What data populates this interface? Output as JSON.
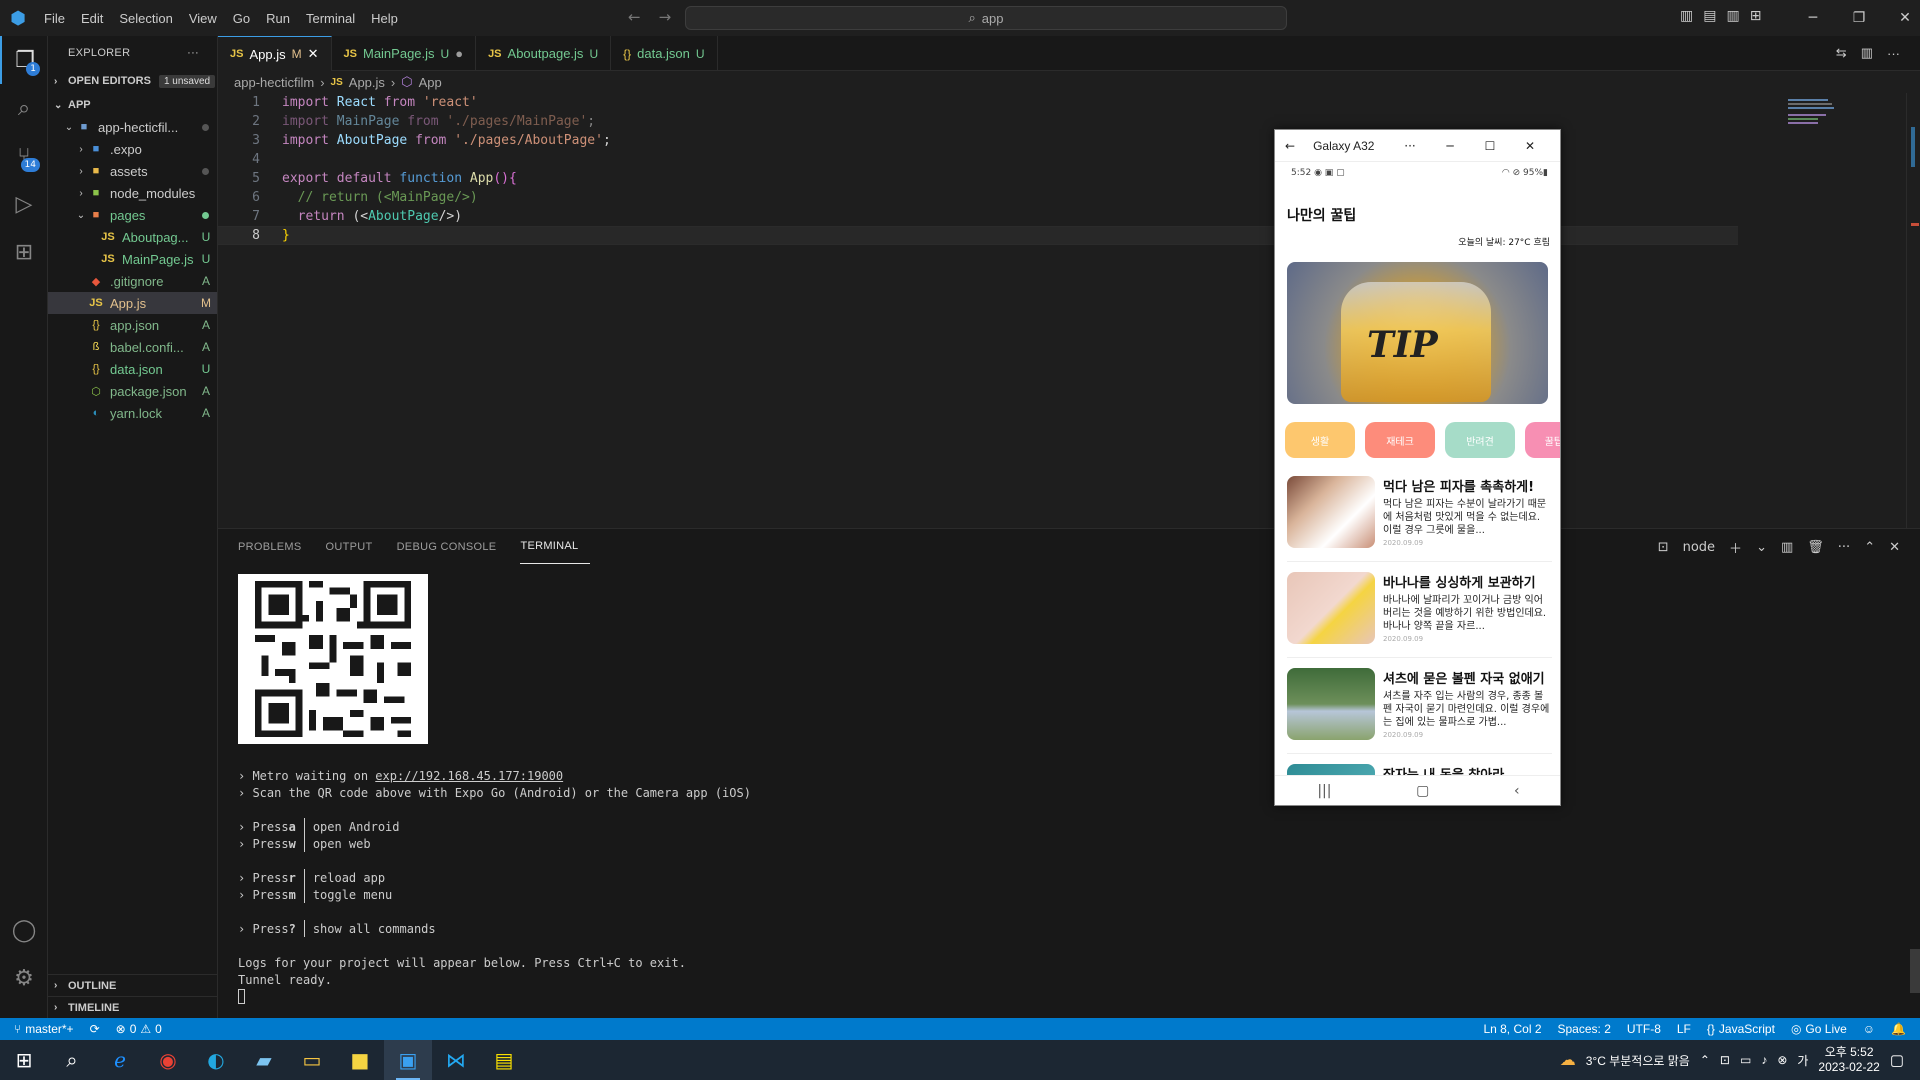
{
  "titlebar": {
    "menu": [
      "File",
      "Edit",
      "Selection",
      "View",
      "Go",
      "Run",
      "Terminal",
      "Help"
    ],
    "search": "app"
  },
  "activity": {
    "explorer_badge": "1",
    "scm_badge": "14"
  },
  "explorer": {
    "title": "EXPLORER",
    "open_editors": "OPEN EDITORS",
    "unsaved": "1 unsaved",
    "app_section": "APP",
    "root_folder": "app-hecticfil...",
    "items": [
      {
        "name": ".expo",
        "status": ""
      },
      {
        "name": "assets",
        "status": ""
      },
      {
        "name": "node_modules",
        "status": ""
      },
      {
        "name": "pages",
        "status": ""
      },
      {
        "name": "Aboutpag...",
        "status": "U"
      },
      {
        "name": "MainPage.js",
        "status": "U"
      },
      {
        "name": ".gitignore",
        "status": "A"
      },
      {
        "name": "App.js",
        "status": "M"
      },
      {
        "name": "app.json",
        "status": "A"
      },
      {
        "name": "babel.confi...",
        "status": "A"
      },
      {
        "name": "data.json",
        "status": "U"
      },
      {
        "name": "package.json",
        "status": "A"
      },
      {
        "name": "yarn.lock",
        "status": "A"
      }
    ],
    "outline": "OUTLINE",
    "timeline": "TIMELINE"
  },
  "tabs": [
    {
      "name": "App.js",
      "mark": "M"
    },
    {
      "name": "MainPage.js",
      "mark": "U"
    },
    {
      "name": "Aboutpage.js",
      "mark": "U"
    },
    {
      "name": "data.json",
      "mark": "U"
    }
  ],
  "breadcrumb": {
    "folder": "app-hecticfilm",
    "file": "App.js",
    "symbol": "App"
  },
  "code": {
    "line_numbers": [
      "1",
      "2",
      "3",
      "4",
      "5",
      "6",
      "7",
      "8"
    ],
    "l1": {
      "kw": "import",
      "id": "React",
      "from": "from",
      "str": "'react'"
    },
    "l2": {
      "kw": "import",
      "id": "MainPage",
      "from": "from",
      "str": "'./pages/MainPage'",
      "end": ";"
    },
    "l3": {
      "kw": "import",
      "id": "AboutPage",
      "from": "from",
      "str": "'./pages/AboutPage'",
      "end": ";"
    },
    "l5": {
      "kw1": "export",
      "kw2": "default",
      "kw3": "function",
      "fn": "App",
      "paren": "()",
      "brace": "{"
    },
    "l6": {
      "cmt": "// return (<MainPage/>)"
    },
    "l7": {
      "kw": "return",
      "open": "(<",
      "tag": "AboutPage",
      "close": "/>)"
    },
    "l8": {
      "brace": "}"
    }
  },
  "panel": {
    "tabs": [
      "PROBLEMS",
      "OUTPUT",
      "DEBUG CONSOLE",
      "TERMINAL"
    ],
    "shell": "node"
  },
  "terminal": {
    "metro_prefix": "› Metro waiting on ",
    "metro_url": "exp://192.168.45.177:19000",
    "scan": "› Scan the QR code above with Expo Go (Android) or the Camera app (iOS)",
    "press": "› Press",
    "cmds": [
      {
        "key": "a",
        "desc": "open Android"
      },
      {
        "key": "w",
        "desc": "open web"
      },
      {
        "key": "r",
        "desc": "reload app"
      },
      {
        "key": "m",
        "desc": "toggle menu"
      },
      {
        "key": "?",
        "desc": "show all commands"
      }
    ],
    "logs": "Logs for your project will appear below. Press Ctrl+C to exit.",
    "tunnel": "Tunnel ready."
  },
  "statusbar": {
    "branch": "master*+",
    "errors": "0",
    "warnings": "0",
    "position": "Ln 8, Col 2",
    "spaces": "Spaces: 2",
    "encoding": "UTF-8",
    "eol": "LF",
    "language": "JavaScript",
    "golive": "Go Live"
  },
  "phone": {
    "device": "Galaxy A32",
    "time": "5:52",
    "battery": "95%",
    "app_title": "나만의 꿀팁",
    "weather": "오늘의 날씨: 27°C 흐림",
    "hero_text": "TIP",
    "categories": [
      {
        "label": "생활",
        "color": "#fdc76e"
      },
      {
        "label": "재테크",
        "color": "#fd8c7b"
      },
      {
        "label": "반려견",
        "color": "#a6dcc8"
      },
      {
        "label": "꿀팁 찜",
        "color": "#f78fb3"
      }
    ],
    "cards": [
      {
        "title": "먹다 남은 피자를 촉촉하게!",
        "desc": "먹다 남은 피자는 수분이 날라가기 때문에 처음처럼 맛있게 먹을 수 없는데요. 이럴 경우 그릇에 물을...",
        "date": "2020.09.09",
        "color": "#c98f76"
      },
      {
        "title": "바나나를 싱싱하게 보관하기",
        "desc": "바나나에 날파리가 꼬이거나 금방 익어버리는 것을 예방하기 위한 방법인데요. 바나나 양쪽 끝을 자르...",
        "date": "2020.09.09",
        "color": "#e8c6b8"
      },
      {
        "title": "셔츠에 묻은 볼펜 자국 없애기",
        "desc": "셔츠를 자주 입는 사람의 경우, 종종 볼펜 자국이 묻기 마련인데요. 이럴 경우에는 집에 있는 물파스로 가볍...",
        "date": "2020.09.09",
        "color": "#6d8f5a"
      },
      {
        "title": "잠자는 내 돈을 찾아라",
        "desc": "",
        "date": "",
        "color": "#3fa0a8"
      }
    ]
  },
  "taskbar": {
    "weather": "3°C 부분적으로 맑음",
    "time": "오후 5:52",
    "date": "2023-02-22"
  }
}
